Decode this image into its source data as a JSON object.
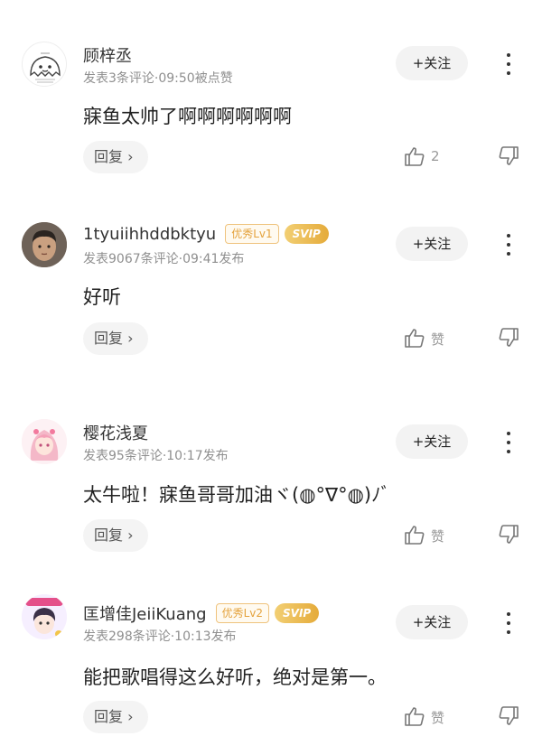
{
  "comments": [
    {
      "username": "顾梓丞",
      "level_badge": "",
      "vip_badge": "",
      "meta": "发表3条评论·09:50被点赞",
      "follow_label": "+关注",
      "content": "寐鱼太帅了啊啊啊啊啊啊",
      "reply_label": "回复 ›",
      "like_label": "2",
      "avatar_icon": "ghost-doodle-avatar"
    },
    {
      "username": "1tyuiihhddbktyu",
      "level_badge": "优秀Lv1",
      "vip_badge": "SVIP",
      "meta": "发表9067条评论·09:41发布",
      "follow_label": "+关注",
      "content": "好听",
      "reply_label": "回复 ›",
      "like_label": "赞",
      "avatar_icon": "person-photo-avatar"
    },
    {
      "username": "樱花浅夏",
      "level_badge": "",
      "vip_badge": "",
      "meta": "发表95条评论·10:17发布",
      "follow_label": "+关注",
      "content": "太牛啦！寐鱼哥哥加油ヾ(◍°∇°◍)ﾉﾞ",
      "reply_label": "回复 ›",
      "like_label": "赞",
      "avatar_icon": "anime-girl-avatar"
    },
    {
      "username": "匡增佳JeiiKuang",
      "level_badge": "优秀Lv2",
      "vip_badge": "SVIP",
      "meta": "发表298条评论·10:13发布",
      "follow_label": "+关注",
      "content": "能把歌唱得这么好听，绝对是第一。",
      "reply_label": "回复 ›",
      "like_label": "赞",
      "avatar_icon": "anime-boy-avatar"
    }
  ],
  "colors": {
    "level_badge": "#e4a23c",
    "vip_badge": "#e5ab3a",
    "meta_text": "#8f8f8f",
    "button_bg": "#f3f3f3"
  }
}
